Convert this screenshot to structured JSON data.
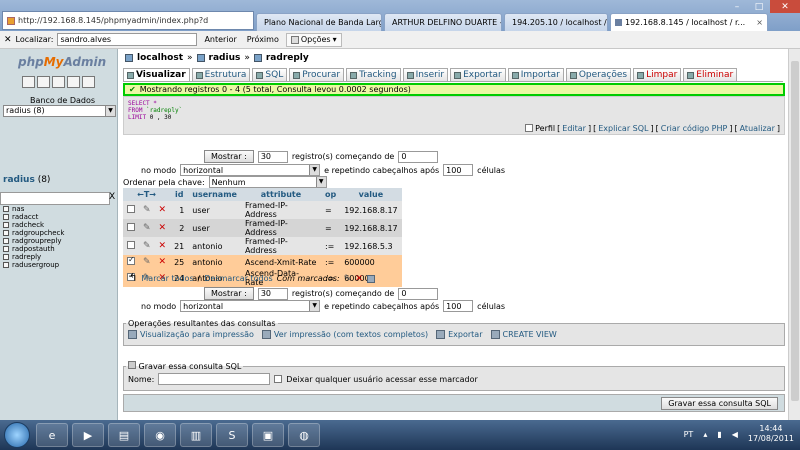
{
  "browser": {
    "url": "http://192.168.8.145/phpmyadmin/index.php?d",
    "tabs": [
      {
        "label": "Plano Nacional de Banda Larg..."
      },
      {
        "label": "ARTHUR DELFINO DUARTE - O..."
      },
      {
        "label": "194.205.10 / localhost / rad..."
      },
      {
        "label": "192.168.8.145 / localhost / r..."
      }
    ],
    "close_glyph": "×"
  },
  "findbar": {
    "label": "Localizar:",
    "value": "sandro.alves",
    "prev": "Anterior",
    "next": "Próximo",
    "options": "Opções"
  },
  "sidebar": {
    "logo_php": "php",
    "logo_my": "My",
    "logo_admin": "Admin",
    "db_label": "Banco de Dados",
    "db_select": "radius (8)",
    "db_title_name": "radius",
    "db_title_count": "(8)",
    "filter_clear": "X",
    "tables": [
      "nas",
      "radacct",
      "radcheck",
      "radgroupcheck",
      "radgroupreply",
      "radpostauth",
      "radreply",
      "radusergroup"
    ]
  },
  "breadcrumb": {
    "server": "localhost",
    "database": "radius",
    "table": "radreply",
    "sep": "»"
  },
  "tabs": [
    {
      "label": "Visualizar",
      "active": true
    },
    {
      "label": "Estrutura"
    },
    {
      "label": "SQL"
    },
    {
      "label": "Procurar"
    },
    {
      "label": "Tracking"
    },
    {
      "label": "Inserir"
    },
    {
      "label": "Exportar"
    },
    {
      "label": "Importar"
    },
    {
      "label": "Operações"
    },
    {
      "label": "Limpar",
      "danger": true
    },
    {
      "label": "Eliminar",
      "danger": true
    }
  ],
  "message": "Mostrando registros 0 - 4 (5 total, Consulta levou 0.0002 segundos)",
  "sql": {
    "line1": "SELECT *",
    "line2_kw": "FROM",
    "line2_val": "`radreply`",
    "line3_kw": "LIMIT",
    "line3_val": "0 , 30",
    "profile": "Perfil",
    "edit": "Editar",
    "explain": "Explicar SQL",
    "create_php": "Criar código PHP",
    "refresh": "Atualizar"
  },
  "nav": {
    "show_btn": "Mostrar :",
    "rows": "30",
    "records_from": "registro(s) começando de",
    "start": "0",
    "in_mode": "no modo",
    "mode": "horizontal",
    "repeat_headers": "e repetindo cabeçalhos após",
    "repeat_count": "100",
    "cells": "células",
    "sort_by_key": "Ordenar pela chave:",
    "sort_value": "Nenhum"
  },
  "table": {
    "columns": [
      "id",
      "username",
      "attribute",
      "op",
      "value"
    ],
    "rows": [
      {
        "id": "1",
        "username": "user",
        "attribute": "Framed-IP-Address",
        "op": "=",
        "value": "192.168.8.17",
        "checked": false
      },
      {
        "id": "2",
        "username": "user",
        "attribute": "Framed-IP-Address",
        "op": "=",
        "value": "192.168.8.17",
        "checked": false
      },
      {
        "id": "21",
        "username": "antonio",
        "attribute": "Framed-IP-Address",
        "op": ":=",
        "value": "192.168.5.3",
        "checked": false
      },
      {
        "id": "25",
        "username": "antonio",
        "attribute": "Ascend-Xmit-Rate",
        "op": ":=",
        "value": "600000",
        "checked": true
      },
      {
        "id": "24",
        "username": "antonio",
        "attribute": "Ascend-Data-Rate",
        "op": ":=",
        "value": "600000",
        "checked": true
      }
    ]
  },
  "markall": {
    "check_all": "Marcar todos",
    "slash": "/",
    "uncheck_all": "Desmarcar todos",
    "with_selected": "Com marcados:"
  },
  "operations": {
    "legend": "Operações resultantes das consultas",
    "print_view": "Visualização para impressão",
    "print_full": "Ver impressão (com textos completos)",
    "export": "Exportar",
    "create_view": "CREATE VIEW"
  },
  "bookmark": {
    "legend": "Gravar essa consulta SQL",
    "name_label": "Nome:",
    "public_label": "Deixar qualquer usuário acessar esse marcador",
    "save_btn": "Gravar essa consulta SQL"
  },
  "taskbar": {
    "lang": "PT",
    "time": "14:44",
    "date": "17/08/2011"
  }
}
